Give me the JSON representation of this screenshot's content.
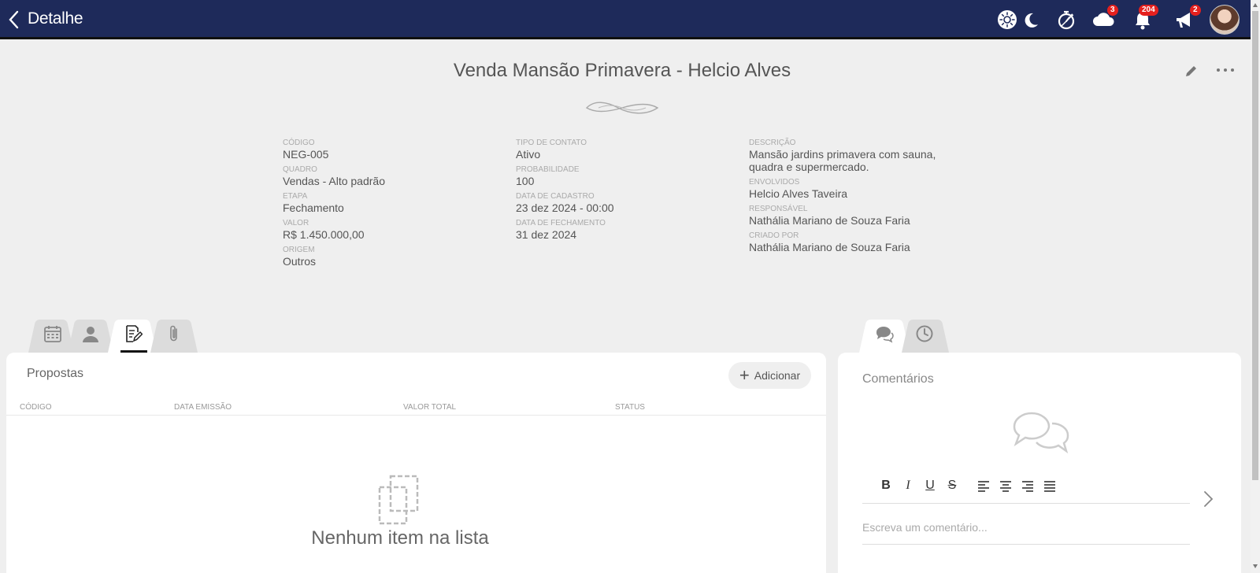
{
  "topbar": {
    "title": "Detalhe",
    "badges": {
      "cloud": "3",
      "notifications": "204",
      "announcements": "2"
    }
  },
  "header": {
    "title": "Venda Mansão Primavera - Helcio Alves"
  },
  "fields": {
    "col1": [
      {
        "label": "CÓDIGO",
        "value": "NEG-005"
      },
      {
        "label": "QUADRO",
        "value": "Vendas - Alto padrão"
      },
      {
        "label": "ETAPA",
        "value": "Fechamento"
      },
      {
        "label": "VALOR",
        "value": "R$ 1.450.000,00"
      },
      {
        "label": "ORIGEM",
        "value": "Outros"
      }
    ],
    "col2": [
      {
        "label": "TIPO DE CONTATO",
        "value": "Ativo"
      },
      {
        "label": "PROBABILIDADE",
        "value": "100"
      },
      {
        "label": "DATA DE CADASTRO",
        "value": "23 dez 2024 - 00:00"
      },
      {
        "label": "DATA DE FECHAMENTO",
        "value": "31 dez 2024"
      }
    ],
    "col3": [
      {
        "label": "DESCRIÇÃO",
        "value_line1": "Mansão jardins primavera com sauna,",
        "value_line2": "quadra e supermercado."
      },
      {
        "label": "ENVOLVIDOS",
        "value": "Helcio Alves Taveira"
      },
      {
        "label": "RESPONSÁVEL",
        "value": "Nathália Mariano de Souza Faria"
      },
      {
        "label": "CRIADO POR",
        "value": "Nathália Mariano de Souza Faria"
      }
    ]
  },
  "proposals": {
    "title": "Propostas",
    "add_label": "Adicionar",
    "columns": [
      "CÓDIGO",
      "DATA EMISSÃO",
      "VALOR TOTAL",
      "STATUS"
    ],
    "empty_text": "Nenhum item na lista"
  },
  "comments": {
    "title": "Comentários",
    "toolbar": [
      "B",
      "I",
      "U",
      "S"
    ],
    "placeholder": "Escreva um comentário..."
  },
  "colors": {
    "topbar": "#1e2a5a",
    "badge": "#e5201e",
    "background": "#efefef"
  }
}
